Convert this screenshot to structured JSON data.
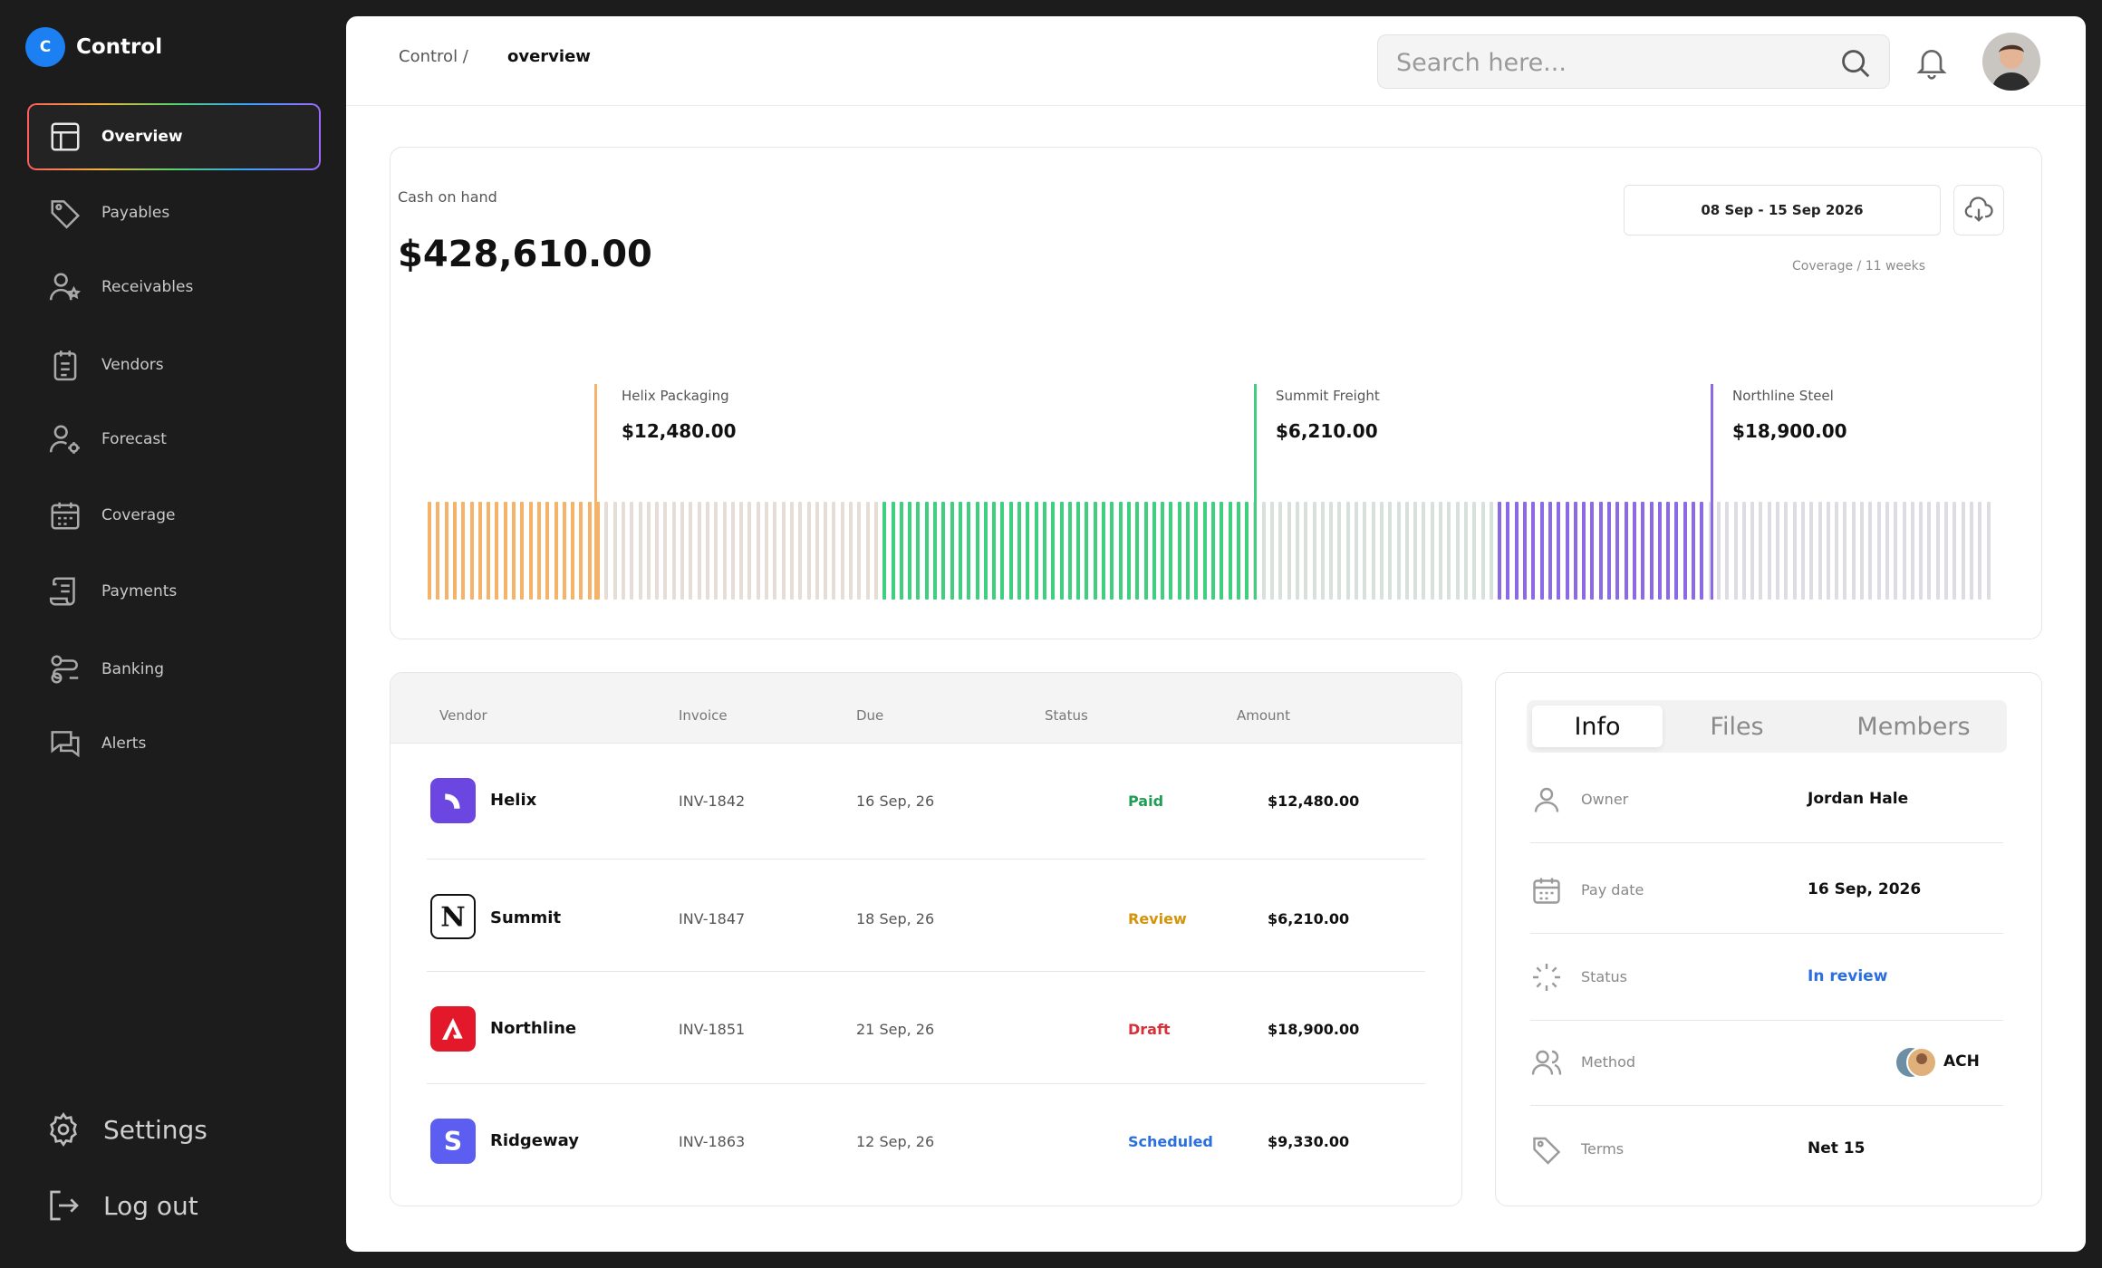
{
  "brand": {
    "initial": "C",
    "name": "Control"
  },
  "sidebar": {
    "items": [
      {
        "label": "Overview",
        "icon": "layout-icon"
      },
      {
        "label": "Payables",
        "icon": "tag-icon"
      },
      {
        "label": "Receivables",
        "icon": "users-star-icon"
      },
      {
        "label": "Vendors",
        "icon": "clipboard-icon"
      },
      {
        "label": "Forecast",
        "icon": "user-gear-icon"
      },
      {
        "label": "Coverage",
        "icon": "calendar-icon"
      },
      {
        "label": "Payments",
        "icon": "scroll-icon"
      },
      {
        "label": "Banking",
        "icon": "route-icon"
      },
      {
        "label": "Alerts",
        "icon": "chat-icon"
      }
    ],
    "settings_label": "Settings",
    "logout_label": "Log out"
  },
  "header": {
    "breadcrumb_root": "Control /",
    "breadcrumb_current": "overview",
    "search_placeholder": "Search here..."
  },
  "cash": {
    "label": "Cash on hand",
    "value": "$428,610.00",
    "date_range": "08 Sep - 15 Sep 2026",
    "coverage": "Coverage / 11 weeks"
  },
  "chart_markers": [
    {
      "name": "Helix Packaging",
      "value": "$12,480.00",
      "color": "#f5b26b"
    },
    {
      "name": "Summit Freight",
      "value": "$6,210.00",
      "color": "#3fcf7f"
    },
    {
      "name": "Northline Steel",
      "value": "$18,900.00",
      "color": "#8c6ae6"
    }
  ],
  "chart_data": {
    "type": "bar",
    "segments": [
      {
        "color": "#f5b26b",
        "count": 21
      },
      {
        "color": "#e5ddd6",
        "count": 33
      },
      {
        "color": "#3fcf7f",
        "count": 44
      },
      {
        "color": "#d8e0dc",
        "count": 29
      },
      {
        "color": "#8c6ae6",
        "count": 25
      },
      {
        "color": "#dcdce2",
        "count": 34
      }
    ]
  },
  "table": {
    "headers": [
      "Vendor",
      "Invoice",
      "Due",
      "Status",
      "Amount"
    ],
    "rows": [
      {
        "vendor": "Helix",
        "invoice": "INV-1842",
        "due": "16 Sep, 26",
        "status": "Paid",
        "status_color": "#1f9d55",
        "amount": "$12,480.00",
        "logo": "helix-logo-icon",
        "logo_color": "#6b46e0"
      },
      {
        "vendor": "Summit",
        "invoice": "INV-1847",
        "due": "18 Sep, 26",
        "status": "Review",
        "status_color": "#d4940a",
        "amount": "$6,210.00",
        "logo": "summit-logo-icon",
        "logo_color": "#111111"
      },
      {
        "vendor": "Northline",
        "invoice": "INV-1851",
        "due": "21 Sep, 26",
        "status": "Draft",
        "status_color": "#d6303a",
        "amount": "$18,900.00",
        "logo": "northline-logo-icon",
        "logo_color": "#e3192b"
      },
      {
        "vendor": "Ridgeway",
        "invoice": "INV-1863",
        "due": "12 Sep, 26",
        "status": "Scheduled",
        "status_color": "#2a6ee0",
        "amount": "$9,330.00",
        "logo": "ridgeway-logo-icon",
        "logo_color": "#5b5ef0"
      }
    ]
  },
  "info": {
    "tabs": [
      "Info",
      "Files",
      "Members"
    ],
    "rows": [
      {
        "label": "Owner",
        "value": "Jordan Hale",
        "icon": "user-icon"
      },
      {
        "label": "Pay date",
        "value": "16 Sep, 2026",
        "icon": "calendar-icon"
      },
      {
        "label": "Status",
        "value": "In review",
        "icon": "loader-icon",
        "value_color": "#2a6ee0"
      },
      {
        "label": "Method",
        "value": "ACH",
        "icon": "users-icon"
      },
      {
        "label": "Terms",
        "value": "Net 15",
        "icon": "tag-icon"
      }
    ]
  }
}
